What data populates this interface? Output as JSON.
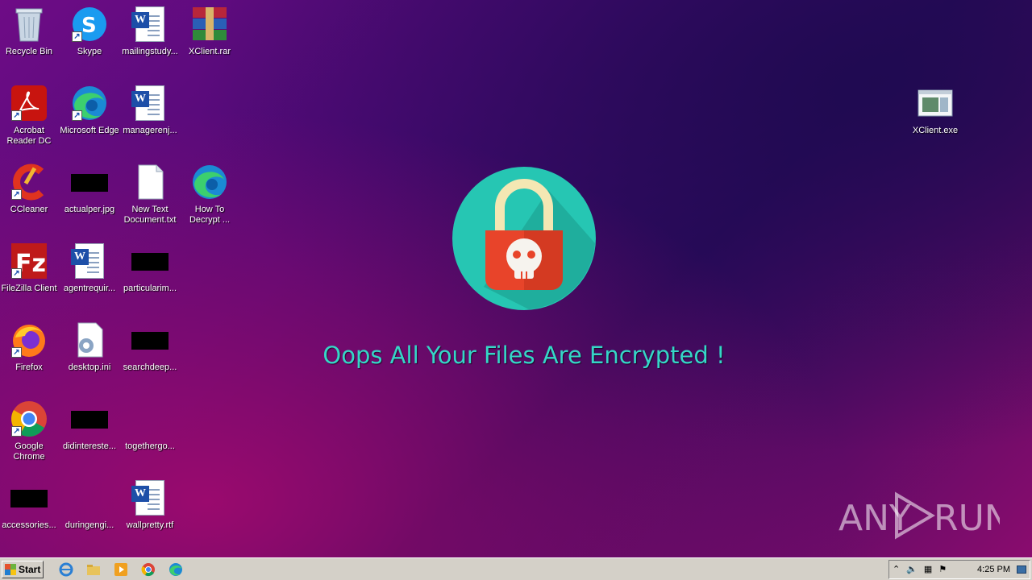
{
  "desktop": {
    "icons": [
      {
        "label": "Recycle Bin"
      },
      {
        "label": "Skype"
      },
      {
        "label": "mailingstudy..."
      },
      {
        "label": "XClient.rar"
      },
      {
        "label": "Acrobat Reader DC"
      },
      {
        "label": "Microsoft Edge"
      },
      {
        "label": "managerenj..."
      },
      {
        "label": "CCleaner"
      },
      {
        "label": "actualper.jpg"
      },
      {
        "label": "New Text Document.txt"
      },
      {
        "label": "How To Decrypt ..."
      },
      {
        "label": "FileZilla Client"
      },
      {
        "label": "agentrequir..."
      },
      {
        "label": "particularim..."
      },
      {
        "label": "Firefox"
      },
      {
        "label": "desktop.ini"
      },
      {
        "label": "searchdeep..."
      },
      {
        "label": "Google Chrome"
      },
      {
        "label": "didintereste..."
      },
      {
        "label": "togethergo..."
      },
      {
        "label": "accessories..."
      },
      {
        "label": "duringengi..."
      },
      {
        "label": "wallpretty.rtf"
      },
      {
        "label": "XClient.exe"
      }
    ],
    "ransom_message": "Oops All Your Files Are Encrypted !",
    "watermark": "ANY RUN"
  },
  "taskbar": {
    "start_label": "Start",
    "clock": "4:25 PM"
  },
  "colors": {
    "message": "#35d6c7",
    "logo_circle": "#26c6b3",
    "lock_body": "#e8442a"
  }
}
